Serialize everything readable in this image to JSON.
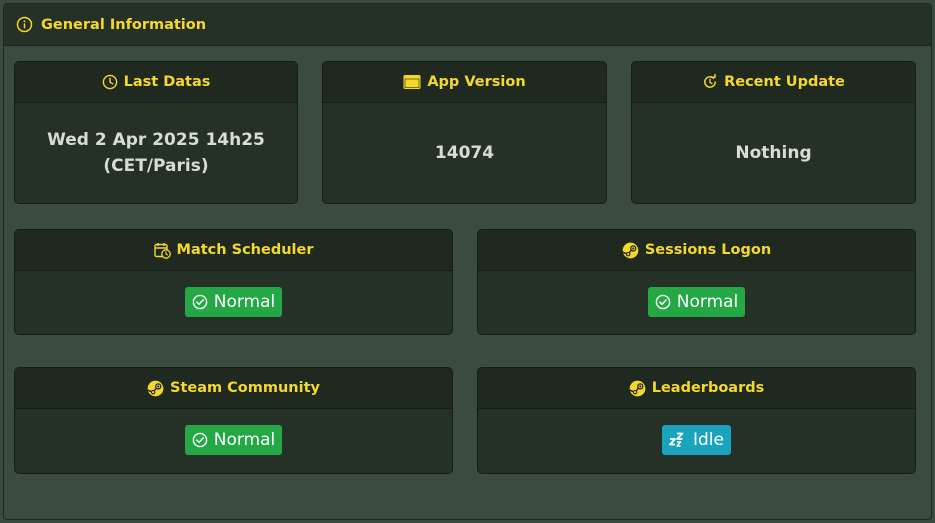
{
  "panel": {
    "title": "General Information",
    "icon": "info-icon"
  },
  "cards": {
    "last_datas": {
      "title": "Last Datas",
      "icon": "clock-icon",
      "line1": "Wed 2 Apr 2025 14h25",
      "line2": "(CET/Paris)"
    },
    "app_version": {
      "title": "App Version",
      "icon": "window-icon",
      "value": "14074"
    },
    "recent_update": {
      "title": "Recent Update",
      "icon": "refresh-icon",
      "value": "Nothing"
    },
    "match_scheduler": {
      "title": "Match Scheduler",
      "icon": "calendar-clock-icon",
      "status": "Normal",
      "status_icon": "check-circle-icon",
      "status_color": "#23a845"
    },
    "sessions_logon": {
      "title": "Sessions Logon",
      "icon": "steam-icon",
      "status": "Normal",
      "status_icon": "check-circle-icon",
      "status_color": "#23a845"
    },
    "steam_community": {
      "title": "Steam Community",
      "icon": "steam-icon",
      "status": "Normal",
      "status_icon": "check-circle-icon",
      "status_color": "#23a845"
    },
    "leaderboards": {
      "title": "Leaderboards",
      "icon": "steam-icon",
      "status": "Idle",
      "status_icon": "sleep-icon",
      "status_color": "#1aa3bd"
    }
  },
  "colors": {
    "accent": "#f4d82a",
    "normal": "#23a845",
    "idle": "#1aa3bd",
    "card_bg": "#253026",
    "page_bg": "#3b4b3f"
  }
}
